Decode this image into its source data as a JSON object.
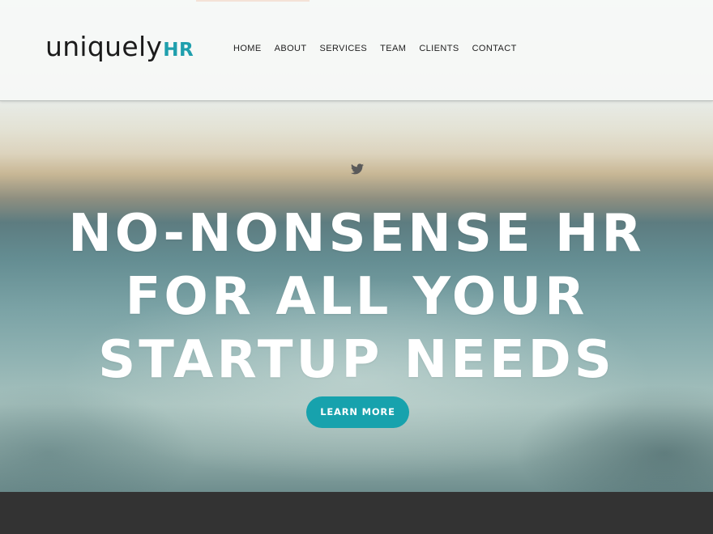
{
  "header": {
    "logo": {
      "main": "uniquely",
      "accent": "HR"
    },
    "nav": [
      {
        "label": "HOME"
      },
      {
        "label": "ABOUT"
      },
      {
        "label": "SERVICES"
      },
      {
        "label": "TEAM"
      },
      {
        "label": "CLIENTS"
      },
      {
        "label": "CONTACT"
      }
    ]
  },
  "hero": {
    "social_icon": "twitter-icon",
    "headline": [
      "NO-NONSENSE HR",
      "FOR ALL YOUR",
      "STARTUP NEEDS"
    ],
    "cta_label": "LEARN MORE"
  },
  "colors": {
    "accent": "#17a2ad",
    "logo_accent": "#1f9fad",
    "footer": "#333333",
    "headline": "#ffffff"
  }
}
